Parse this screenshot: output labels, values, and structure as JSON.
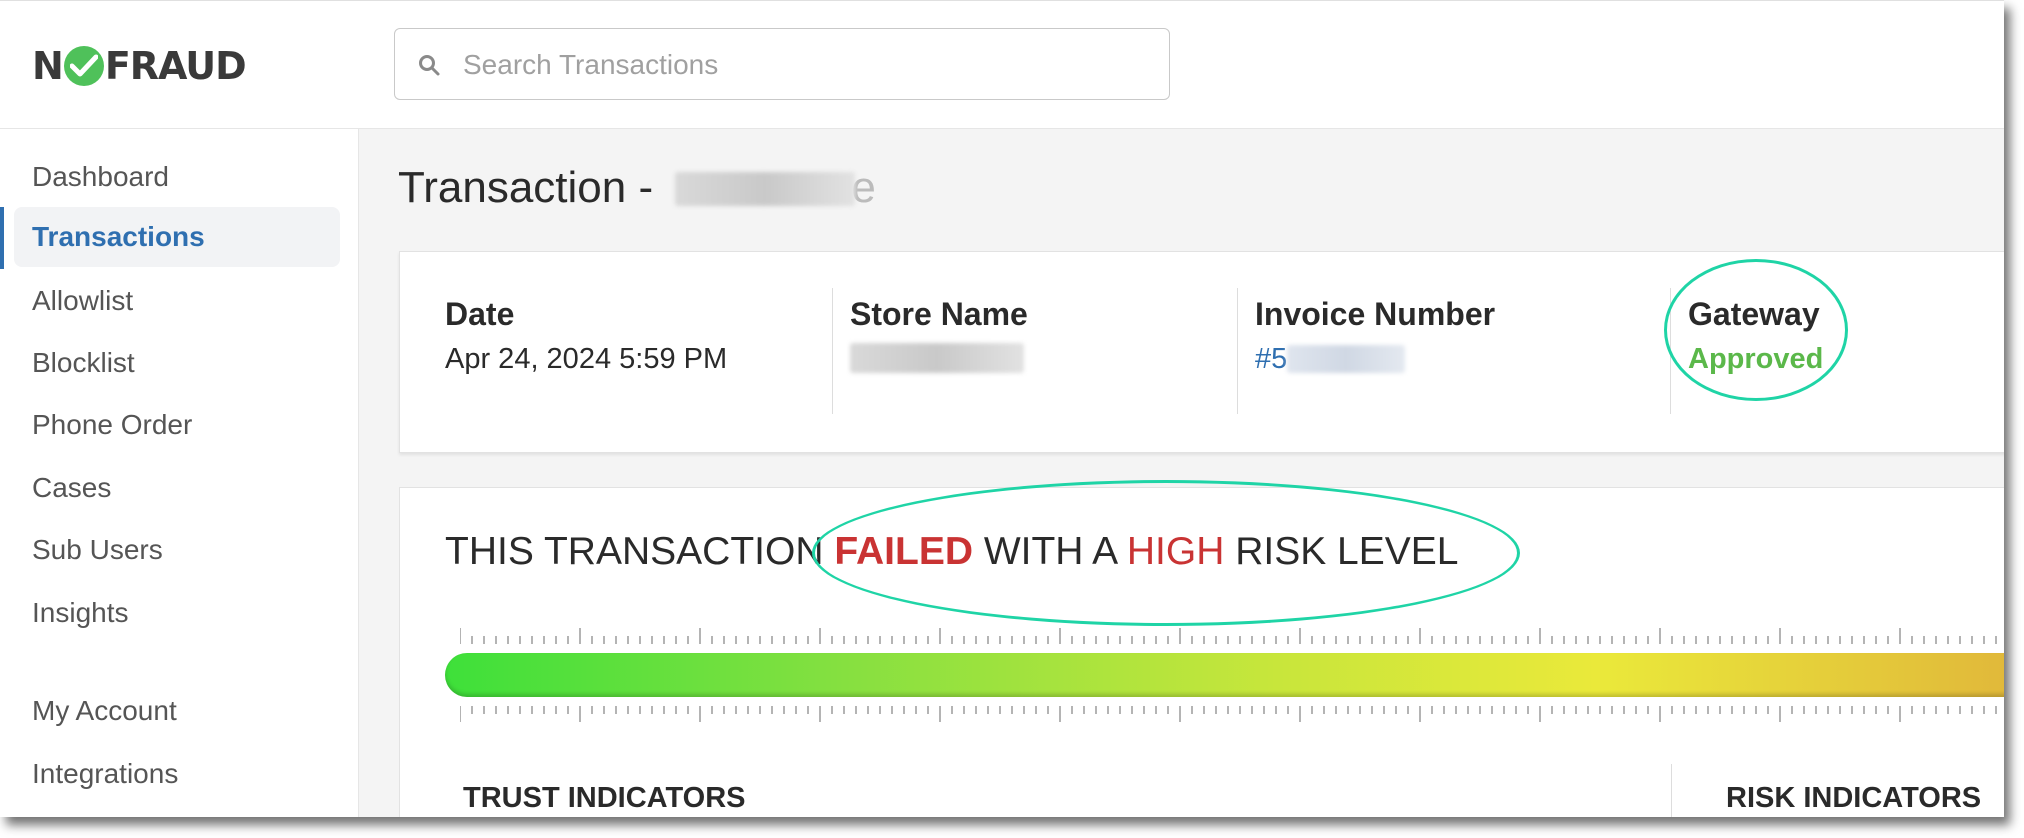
{
  "brand": {
    "logo_text_left": "N",
    "logo_text_right": "FRAUD",
    "logo_check_color": "#4fc15a"
  },
  "search": {
    "placeholder": "Search Transactions"
  },
  "sidebar": {
    "items": [
      {
        "label": "Dashboard"
      },
      {
        "label": "Transactions",
        "active": true
      },
      {
        "label": "Allowlist"
      },
      {
        "label": "Blocklist"
      },
      {
        "label": "Phone Order"
      },
      {
        "label": "Cases"
      },
      {
        "label": "Sub Users"
      },
      {
        "label": "Insights"
      },
      {
        "label": "My Account"
      },
      {
        "label": "Integrations"
      }
    ]
  },
  "transaction": {
    "title_prefix": "Transaction -",
    "title_suffix_visible": "e",
    "details": {
      "date_label": "Date",
      "date_value": "Apr 24, 2024 5:59 PM",
      "store_label": "Store Name",
      "invoice_label": "Invoice Number",
      "invoice_prefix_visible": "#5",
      "gateway_label": "Gateway",
      "gateway_value": "Approved"
    }
  },
  "risk": {
    "text_1": "THIS TRANSACTION ",
    "status": "FAILED",
    "text_2": " WITH A ",
    "level": "HIGH",
    "text_3": " RISK LEVEL"
  },
  "indicators": {
    "trust_label": "TRUST INDICATORS",
    "risk_label": "RISK INDICATORS"
  },
  "colors": {
    "accent": "#2f6fb0",
    "approved": "#5bb84a",
    "failed": "#c93333",
    "highlight_circle": "#1fd4a6"
  }
}
